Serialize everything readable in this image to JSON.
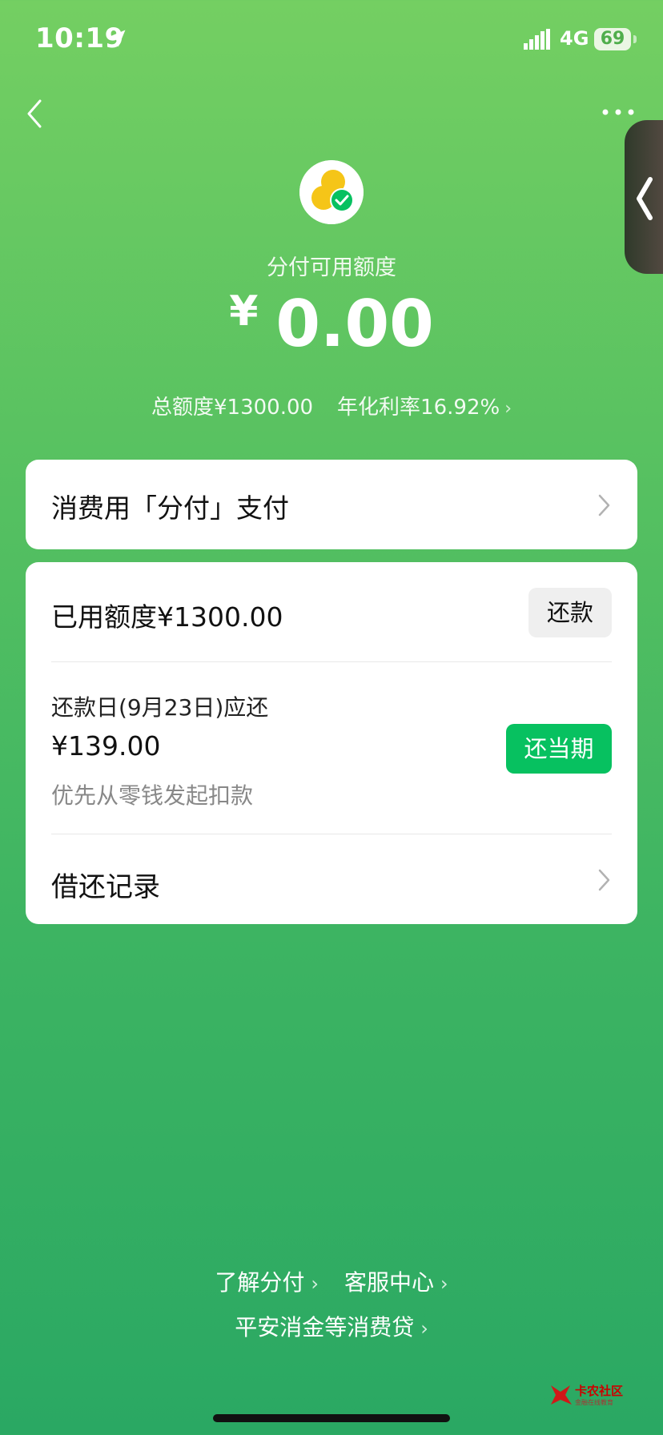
{
  "status_bar": {
    "time": "10:19",
    "network": "4G",
    "battery": "69"
  },
  "header": {
    "back_icon": "chevron-left-icon",
    "more_icon": "more-dots-icon"
  },
  "summary": {
    "label": "分付可用额度",
    "currency_symbol": "¥",
    "available_amount": "0.00",
    "total_limit": "总额度¥1300.00",
    "annual_rate": "年化利率16.92%"
  },
  "pay_card": {
    "label": "消费用「分付」支付"
  },
  "usage_card": {
    "used_label": "已用额度¥1300.00",
    "repay_button": "还款",
    "due_label": "还款日(9月23日)应还",
    "due_amount": "¥139.00",
    "deduction_note": "优先从零钱发起扣款",
    "pay_current_button": "还当期",
    "records_label": "借还记录"
  },
  "footer": {
    "learn_link": "了解分付",
    "service_link": "客服中心",
    "loans_link": "平安消金等消费贷"
  },
  "watermark": {
    "text": "卡农社区",
    "sub": "金融在线教育"
  },
  "colors": {
    "primary_green": "#07c160",
    "bg_top": "#74cf62",
    "bg_bottom": "#2aa863"
  }
}
